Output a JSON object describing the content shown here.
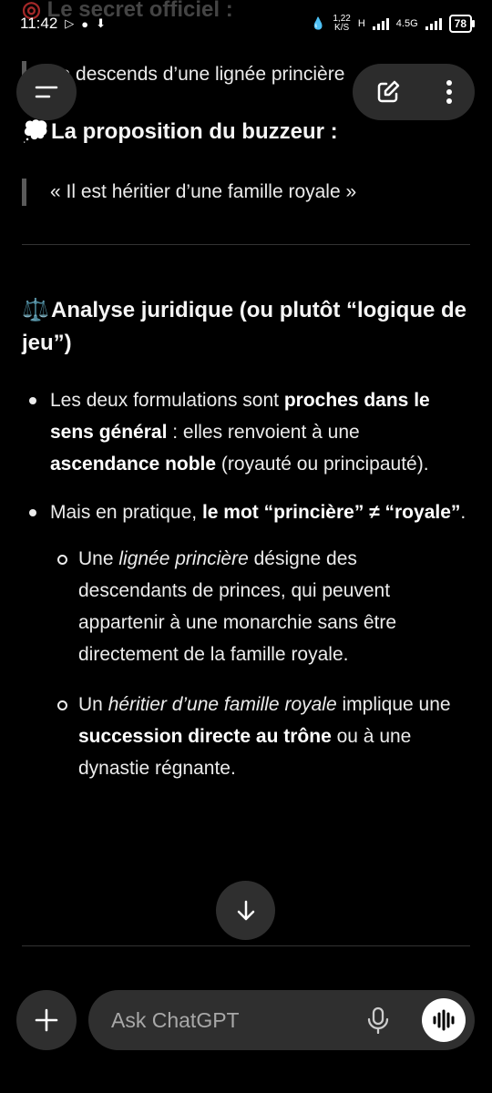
{
  "status": {
    "time": "11:42",
    "rate_top": "1,22",
    "rate_bottom": "K/S",
    "network_h": "H",
    "network_45": "4.5G",
    "battery": "78"
  },
  "top_faded_text": "Le secret officiel :",
  "quote1": "Je descends d’une lignée princière",
  "section_proposal": {
    "icon": "💭",
    "title": "La proposition du buzzeur :"
  },
  "quote2": "« Il est héritier d’une famille royale »",
  "section_analysis": {
    "icon": "⚖️",
    "title": "Analyse juridique (ou plutôt “logique de jeu”)"
  },
  "bullet1": {
    "p1": "Les deux formulations sont ",
    "b1": "proches dans le sens général",
    "p2": " : elles renvoient à une ",
    "b2": "ascendance noble",
    "p3": " (royauté ou principauté)."
  },
  "bullet2": {
    "p1": "Mais en pratique, ",
    "b1": "le mot “princière” ≠ “royale”",
    "p2": "."
  },
  "sub1": {
    "p1": "Une ",
    "i1": "lignée princière",
    "p2": " désigne des descendants de princes, qui peuvent appartenir à une monarchie sans être directement de la famille royale."
  },
  "sub2": {
    "p1": "Un ",
    "i1": "héritier d’une famille royale",
    "p2": " implique une ",
    "b1": "succession directe au trône",
    "p3": " ou à une dynastie régnante."
  },
  "composer": {
    "placeholder": "Ask ChatGPT"
  },
  "icons": {
    "menu": "menu-icon",
    "edit": "edit-icon",
    "more": "more-vertical-icon",
    "scroll": "arrow-down-icon",
    "add": "plus-icon",
    "mic": "mic-icon",
    "voice": "voice-waveform-icon"
  }
}
